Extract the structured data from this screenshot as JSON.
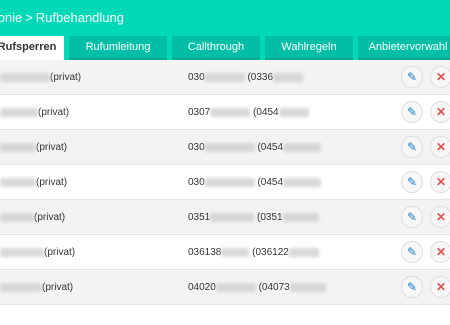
{
  "breadcrumb": {
    "section": "fonie",
    "separator": ">",
    "page": "Rufbehandlung"
  },
  "tabs": [
    {
      "label": "Rufsperren",
      "active": true
    },
    {
      "label": "Rufumleitung",
      "active": false
    },
    {
      "label": "Callthrough",
      "active": false
    },
    {
      "label": "Wahlregeln",
      "active": false
    },
    {
      "label": "Anbietervorwahl",
      "active": false
    }
  ],
  "rows": [
    {
      "name_suffix": "(privat)",
      "num_prefix": "030",
      "num_paren": "(0336"
    },
    {
      "name_suffix": "(privat)",
      "num_prefix": "0307",
      "num_paren": "(0454"
    },
    {
      "name_suffix": "(privat)",
      "num_prefix": "030",
      "num_paren": "(0454"
    },
    {
      "name_suffix": "(privat)",
      "num_prefix": "030",
      "num_paren": "(0454"
    },
    {
      "name_suffix": "(privat)",
      "num_prefix": "0351",
      "num_paren": "(0351"
    },
    {
      "name_suffix": "(privat)",
      "num_prefix": "036138",
      "num_paren": "(036122"
    },
    {
      "name_suffix": "(privat)",
      "num_prefix": "04020",
      "num_paren": "(04073"
    }
  ],
  "icons": {
    "edit": "pencil-icon",
    "delete": "close-icon"
  },
  "colors": {
    "header": "#00d9b8",
    "tab": "#00bfa6",
    "edit": "#1a7fc8",
    "delete": "#e05252"
  }
}
